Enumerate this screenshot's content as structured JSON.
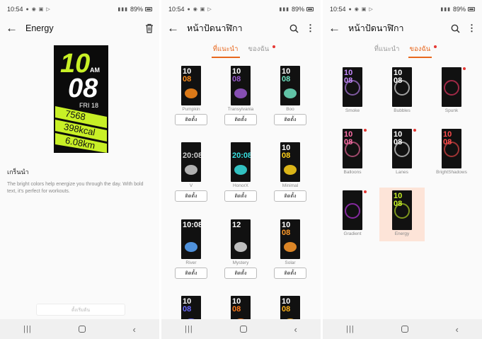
{
  "status": {
    "time": "10:54",
    "battery": "89%"
  },
  "screen1": {
    "title": "Energy",
    "preview": {
      "hour": "10",
      "ampm": "AM",
      "minute": "08",
      "date": "FRI 18",
      "steps": "7568",
      "kcal": "398kcal",
      "km": "6.08km"
    },
    "desc_title": "เกร็นนำ",
    "desc_text": "The bright colors help energize you through the day. With bold text, it's perfect for workouts.",
    "apply_label": "ตั้งเริ่มต้น"
  },
  "screen2": {
    "title": "หน้าปัดนาฬิกา",
    "tabs": [
      {
        "label": "ที่แนะนำ",
        "active": true
      },
      {
        "label": "ของฉัน",
        "active": false
      }
    ],
    "install_label": "ติดตั้ง",
    "faces": [
      {
        "name": "Pumpkin",
        "top": "10",
        "bottom": "08",
        "color": "#ff8c1a"
      },
      {
        "name": "Transylvania",
        "top": "10",
        "bottom": "08",
        "color": "#9b59d0"
      },
      {
        "name": "Boo",
        "top": "10",
        "bottom": "08",
        "color": "#6fe3c1"
      },
      {
        "name": "V",
        "top": "",
        "bottom": "20:08",
        "color": "#cccccc"
      },
      {
        "name": "HonorX",
        "top": "",
        "bottom": "20:08",
        "color": "#38e0e0"
      },
      {
        "name": "Minimal",
        "top": "10",
        "bottom": "08",
        "color": "#ffd21a"
      },
      {
        "name": "River",
        "top": "10:08",
        "bottom": "",
        "color": "#5aa8ff"
      },
      {
        "name": "Mystery",
        "top": "12",
        "bottom": "",
        "color": "#dddddd"
      },
      {
        "name": "Solar",
        "top": "10",
        "bottom": "08",
        "color": "#ff9a2a"
      },
      {
        "name": "",
        "top": "10",
        "bottom": "08",
        "color": "#6a6aff"
      },
      {
        "name": "",
        "top": "10",
        "bottom": "08",
        "color": "#ff7a1a"
      },
      {
        "name": "",
        "top": "10",
        "bottom": "08",
        "color": "#ffb21a"
      }
    ]
  },
  "screen3": {
    "title": "หน้าปัดนาฬิกา",
    "tabs": [
      {
        "label": "ที่แนะนำ",
        "active": false
      },
      {
        "label": "ของฉัน",
        "active": true
      }
    ],
    "faces": [
      {
        "name": "Smoke",
        "top": "10",
        "bottom": "08",
        "color": "#c78bff",
        "new": false
      },
      {
        "name": "Bubbles",
        "top": "10",
        "bottom": "08",
        "color": "#ffffff",
        "new": false
      },
      {
        "name": "Spunk",
        "top": "",
        "bottom": "",
        "color": "#ff3b6b",
        "new": true
      },
      {
        "name": "Balloons",
        "top": "10",
        "bottom": "08",
        "color": "#ff6fa8",
        "new": true
      },
      {
        "name": "Lanes",
        "top": "10",
        "bottom": "08",
        "color": "#ffffff",
        "new": true
      },
      {
        "name": "BrightShadows",
        "top": "10",
        "bottom": "08",
        "color": "#ff4d4d",
        "new": false
      },
      {
        "name": "Gradient",
        "top": "",
        "bottom": "",
        "color": "#d33bff",
        "new": true
      },
      {
        "name": "Energy",
        "top": "10",
        "bottom": "08",
        "color": "#c8f026",
        "new": false
      }
    ]
  }
}
